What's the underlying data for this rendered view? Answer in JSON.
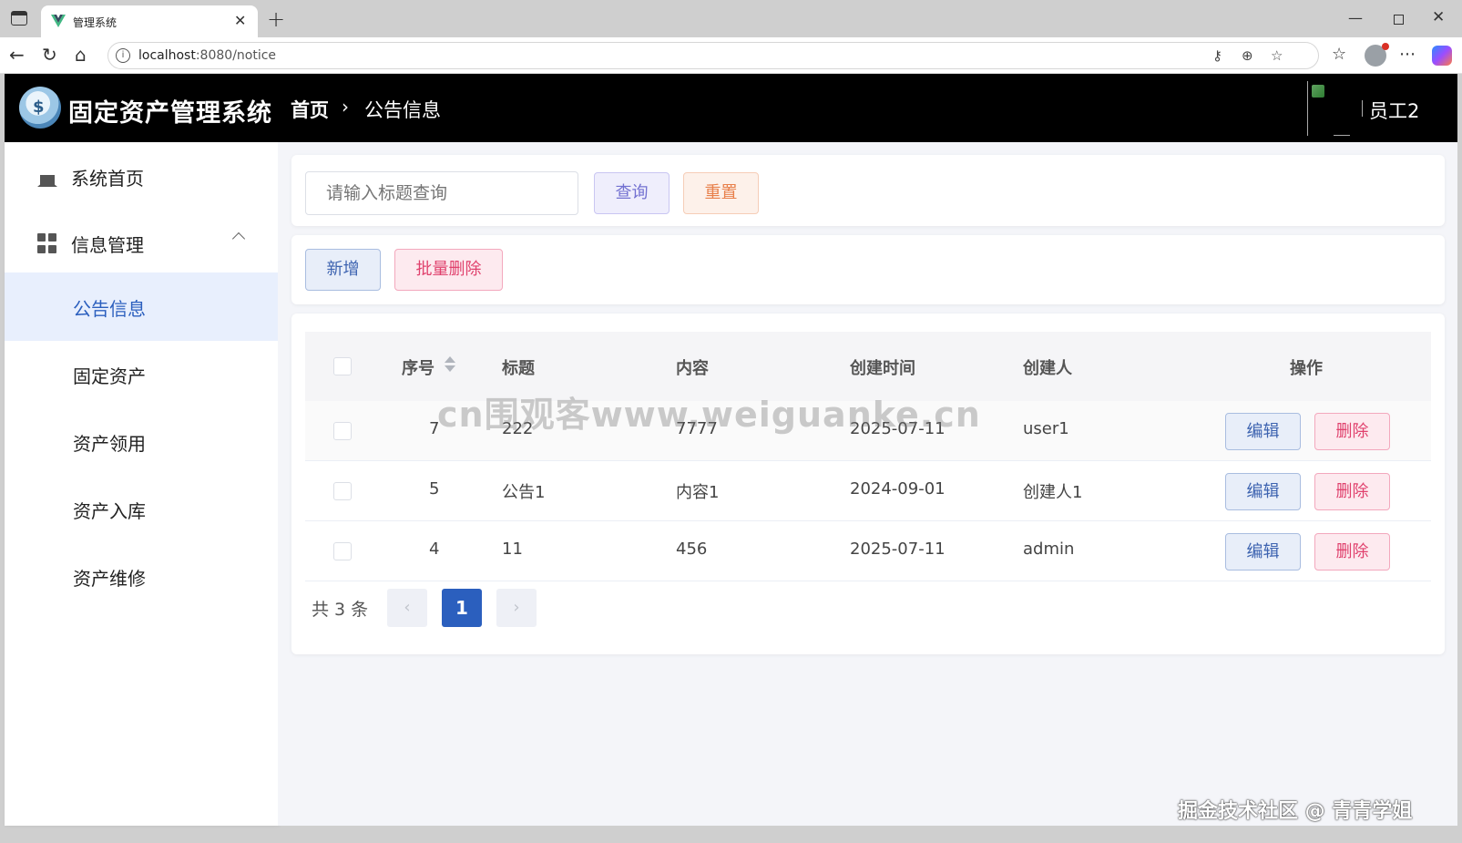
{
  "browser": {
    "tab_title": "管理系统",
    "url_host": "localhost",
    "url_path": ":8080/notice"
  },
  "header": {
    "app_title": "固定资产管理系统",
    "breadcrumb_home": "首页",
    "breadcrumb_current": "公告信息",
    "user_name": "员工2"
  },
  "sidebar": {
    "home_label": "系统首页",
    "group_label": "信息管理",
    "items": [
      {
        "label": "公告信息",
        "active": true
      },
      {
        "label": "固定资产",
        "active": false
      },
      {
        "label": "资产领用",
        "active": false
      },
      {
        "label": "资产入库",
        "active": false
      },
      {
        "label": "资产维修",
        "active": false
      }
    ]
  },
  "search": {
    "placeholder": "请输入标题查询",
    "query_label": "查询",
    "reset_label": "重置"
  },
  "actions": {
    "add_label": "新增",
    "batch_delete_label": "批量删除"
  },
  "table": {
    "columns": [
      "序号",
      "标题",
      "内容",
      "创建时间",
      "创建人",
      "操作"
    ],
    "rows": [
      {
        "id": "7",
        "title": "222",
        "content": "7777",
        "time": "2025-07-11",
        "creator": "user1"
      },
      {
        "id": "5",
        "title": "公告1",
        "content": "内容1",
        "time": "2024-09-01",
        "creator": "创建人1"
      },
      {
        "id": "4",
        "title": "11",
        "content": "456",
        "time": "2025-07-11",
        "creator": "admin"
      }
    ],
    "edit_label": "编辑",
    "delete_label": "删除"
  },
  "pagination": {
    "total_text": "共 3 条",
    "current_page": "1",
    "prev": "‹",
    "next": "›"
  },
  "overlay": {
    "watermark": "cn围观客www.weiguanke.cn",
    "credit": "掘金技术社区 @ 青青学姐"
  }
}
